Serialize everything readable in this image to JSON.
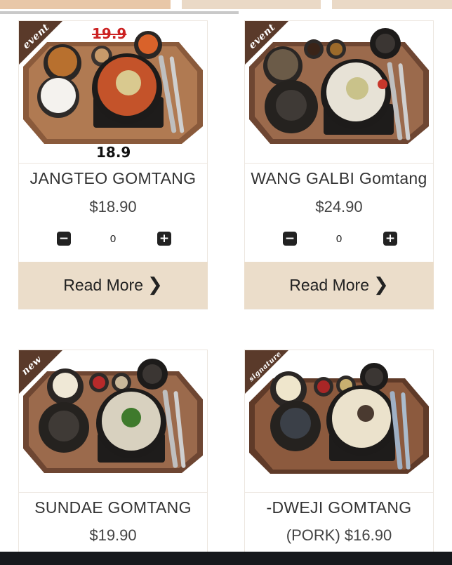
{
  "products": [
    {
      "badge": "event",
      "old_price": "19.9",
      "promo_price": "18.9",
      "name": "JANGTEO GOMTANG",
      "price": "$18.90",
      "quantity": "0",
      "read_more": "Read More"
    },
    {
      "badge": "event",
      "name": "WANG GALBI Gomtang",
      "price": "$24.90",
      "quantity": "0",
      "read_more": "Read More"
    },
    {
      "badge": "new",
      "name": "SUNDAE GOMTANG",
      "price": "$19.90"
    },
    {
      "badge": "signature",
      "name": "-DWEJI GOMTANG",
      "price": "(PORK) $16.90"
    }
  ],
  "icons": {
    "minus": "minus-square-icon",
    "plus": "plus-square-icon",
    "chevron": "chevron-right-icon"
  },
  "colors": {
    "ribbon": "#5a3a2a",
    "read_more_bg": "#ebddca",
    "old_price": "#cc2222"
  }
}
